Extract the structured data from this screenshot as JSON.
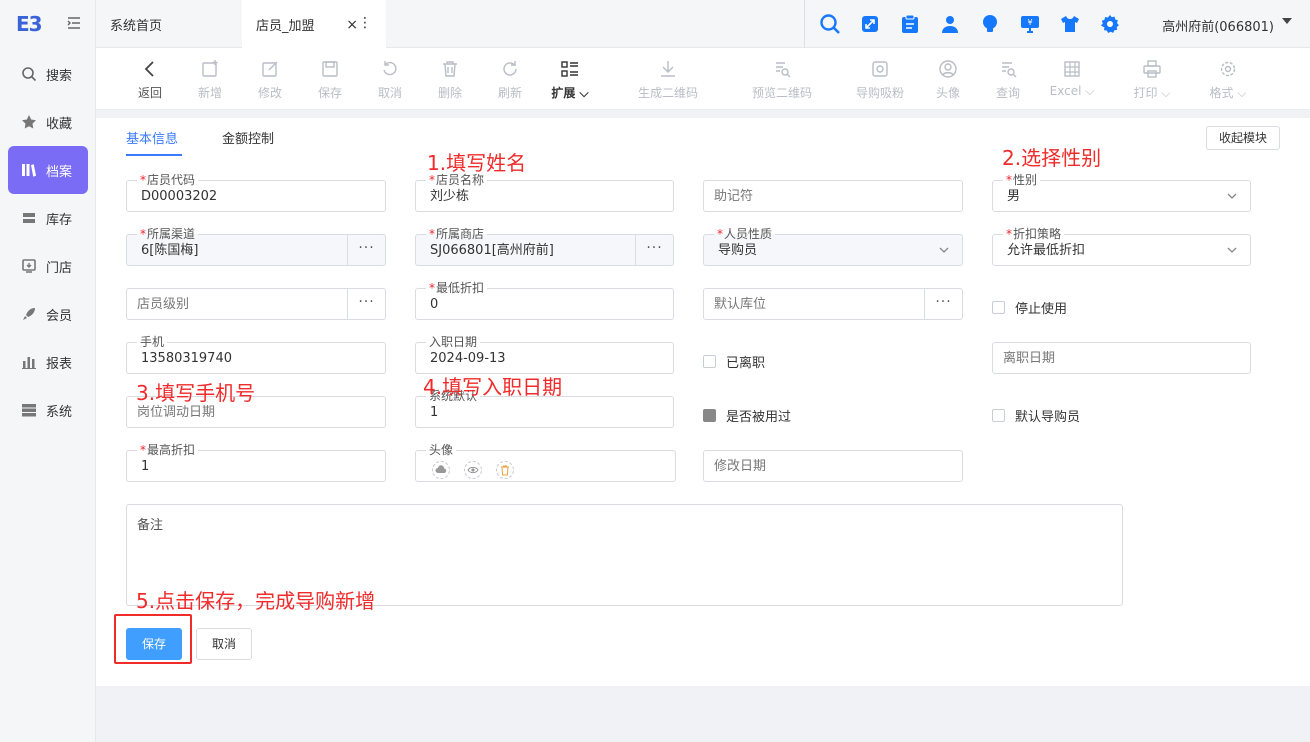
{
  "app": {
    "logo": "E3"
  },
  "sidebar": {
    "items": [
      {
        "label": "搜索",
        "icon": "search-icon"
      },
      {
        "label": "收藏",
        "icon": "star-icon"
      },
      {
        "label": "档案",
        "icon": "archive-icon",
        "active": true
      },
      {
        "label": "库存",
        "icon": "inventory-icon"
      },
      {
        "label": "门店",
        "icon": "store-icon"
      },
      {
        "label": "会员",
        "icon": "rocket-icon"
      },
      {
        "label": "报表",
        "icon": "chart-icon"
      },
      {
        "label": "系统",
        "icon": "server-icon"
      }
    ]
  },
  "tabs": {
    "home": "系统首页",
    "current": "店员_加盟",
    "close": "×",
    "more": "⋮"
  },
  "header": {
    "store": "高州府前(066801)",
    "accent": "#1677ff"
  },
  "toolbar": {
    "back": "返回",
    "new": "新增",
    "edit": "修改",
    "save": "保存",
    "cancel": "取消",
    "delete": "删除",
    "refresh": "刷新",
    "extend": "扩展",
    "gen_qr": "生成二维码",
    "preview_qr": "预览二维码",
    "guide_fans": "导购吸粉",
    "avatar": "头像",
    "query": "查询",
    "excel": "Excel",
    "print": "打印",
    "format": "格式"
  },
  "subtabs": {
    "basic": "基本信息",
    "amount": "金额控制",
    "collapse": "收起模块"
  },
  "form": {
    "staff_code": {
      "label": "店员代码",
      "value": "D00003202"
    },
    "staff_name": {
      "label": "店员名称",
      "value": "刘少栋"
    },
    "mnemonic": {
      "placeholder": "助记符"
    },
    "gender": {
      "label": "性别",
      "value": "男"
    },
    "channel": {
      "label": "所属渠道",
      "value": "6[陈国梅]"
    },
    "shop": {
      "label": "所属商店",
      "value": "SJ066801[高州府前]"
    },
    "person_type": {
      "label": "人员性质",
      "value": "导购员"
    },
    "discount_strategy": {
      "label": "折扣策略",
      "value": "允许最低折扣"
    },
    "staff_level": {
      "placeholder": "店员级别"
    },
    "min_discount": {
      "label": "最低折扣",
      "value": "0"
    },
    "default_warehouse": {
      "placeholder": "默认库位"
    },
    "stop_use": {
      "label": "停止使用"
    },
    "phone": {
      "label": "手机",
      "value": "13580319740"
    },
    "hire_date": {
      "label": "入职日期",
      "value": "2024-09-13"
    },
    "resigned": {
      "label": "已离职"
    },
    "resign_date": {
      "placeholder": "离职日期"
    },
    "transfer_date": {
      "placeholder": "岗位调动日期"
    },
    "sys_default": {
      "label": "系统默认",
      "value": "1"
    },
    "used": {
      "label": "是否被用过"
    },
    "default_guide": {
      "label": "默认导购员"
    },
    "max_discount": {
      "label": "最高折扣",
      "value": "1"
    },
    "avatar": {
      "label": "头像"
    },
    "modify_date": {
      "placeholder": "修改日期"
    },
    "remark": {
      "placeholder": "备注"
    }
  },
  "buttons": {
    "save": "保存",
    "cancel": "取消"
  },
  "annotations": {
    "a1": "1.填写姓名",
    "a2": "2.选择性别",
    "a3": "3.填写手机号",
    "a4": "4.填写入职日期",
    "a5": "5.点击保存，完成导购新增"
  },
  "colors": {
    "annotation": "#f12a2a",
    "active_nav": "#7b6cf6",
    "primary": "#409eff"
  }
}
